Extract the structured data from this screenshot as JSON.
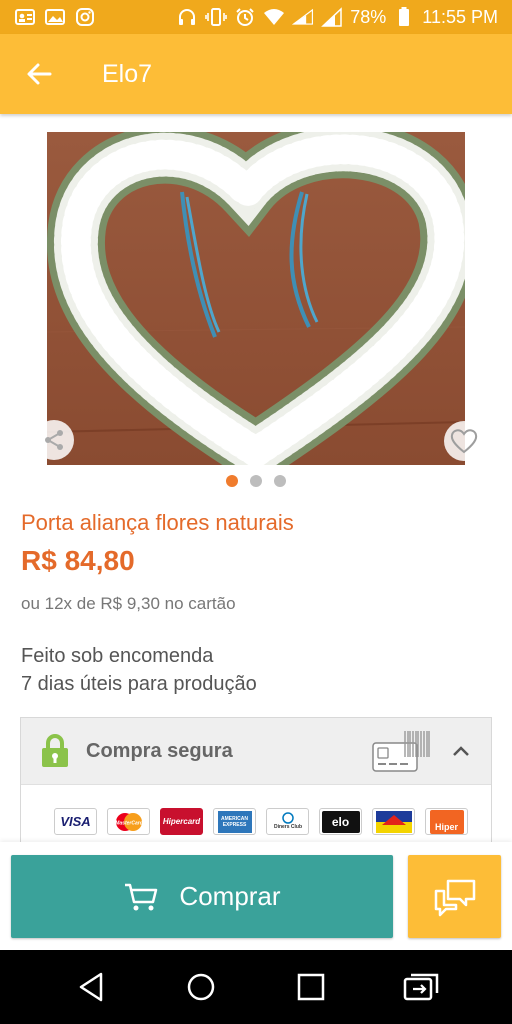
{
  "status_bar": {
    "battery": "78%",
    "time": "11:55 PM"
  },
  "app_bar": {
    "title": "Elo7"
  },
  "product": {
    "title": "Porta aliança flores naturais",
    "price": "R$ 84,80",
    "installments": "ou 12x de R$ 9,30 no cartão",
    "production_line1": "Feito sob encomenda",
    "production_line2": "7 dias úteis para produção"
  },
  "carousel": {
    "dots": 3,
    "active_index": 0
  },
  "secure": {
    "label": "Compra segura",
    "payment_methods": [
      {
        "name": "VISA"
      },
      {
        "name": "MasterCard"
      },
      {
        "name": "Hipercard"
      },
      {
        "name": "AMERICAN EXPRESS"
      },
      {
        "name": "Diners Club"
      },
      {
        "name": "elo"
      },
      {
        "name": "Aura"
      },
      {
        "name": "Hiper"
      }
    ]
  },
  "actions": {
    "buy_label": "Comprar"
  },
  "colors": {
    "accent": "#fdbd37",
    "status": "#f0a91c",
    "price": "#e46a2a",
    "buy": "#3aa29a"
  },
  "icons": {
    "back": "arrow-left-icon",
    "share": "share-icon",
    "favorite": "heart-outline-icon",
    "lock": "lock-icon",
    "cart": "cart-icon",
    "chat": "chat-bubbles-icon"
  }
}
